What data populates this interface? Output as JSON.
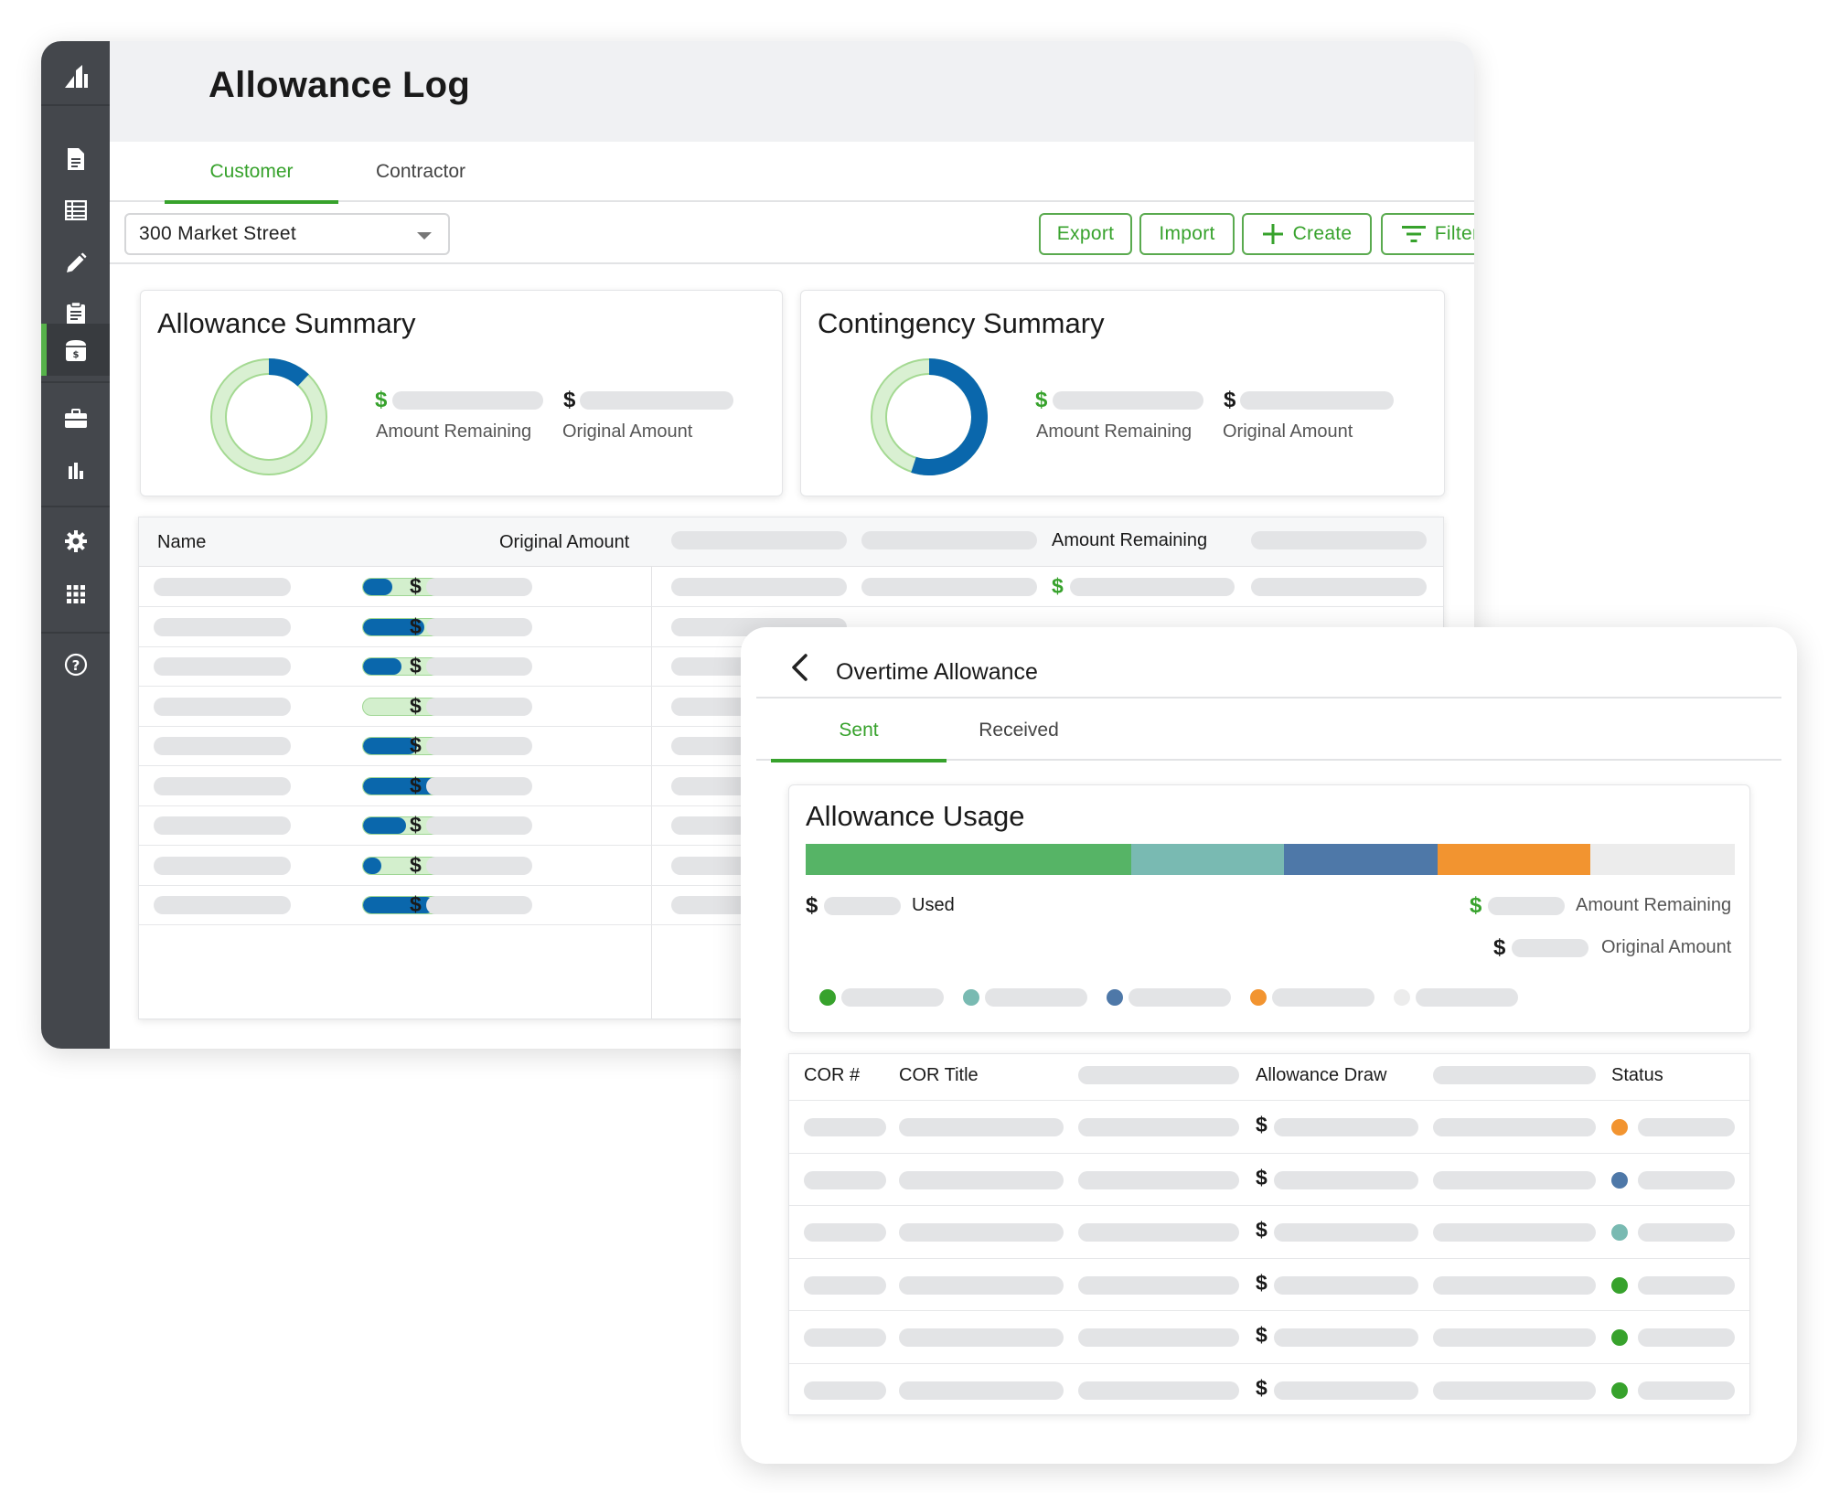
{
  "app": {
    "page_title": "Allowance Log"
  },
  "sidebar": {
    "items": [
      "logo-icon",
      "document-icon",
      "spreadsheet-icon",
      "pencil-icon",
      "clipboard-icon",
      "allowance-icon",
      "briefcase-icon",
      "bar-chart-icon",
      "gear-icon",
      "grid-icon",
      "help-icon"
    ],
    "active_item": "allowance-icon"
  },
  "tabs": [
    {
      "label": "Customer",
      "active": true
    },
    {
      "label": "Contractor",
      "active": false
    }
  ],
  "toolbar": {
    "project_value": "300 Market Street",
    "export_label": "Export",
    "import_label": "Import",
    "create_label": "Create",
    "filter_label": "Filter"
  },
  "allowance_summary": {
    "title": "Allowance Summary",
    "dollar": "$",
    "remaining_label": "Amount Remaining",
    "original_label": "Original Amount",
    "used_fraction": 0.12
  },
  "contingency_summary": {
    "title": "Contingency Summary",
    "dollar": "$",
    "remaining_label": "Amount Remaining",
    "original_label": "Original Amount",
    "used_fraction": 0.55
  },
  "allowance_table": {
    "headers": {
      "name": "Name",
      "original_amount": "Original Amount",
      "amount_remaining": "Amount Remaining"
    },
    "dollar": "$",
    "row_progress": [
      0.33,
      0.68,
      0.43,
      0.0,
      0.6,
      0.87,
      0.48,
      0.2,
      0.8
    ],
    "row_overflow": [
      0,
      0,
      0,
      0,
      0,
      0.17,
      0,
      0,
      0
    ]
  },
  "panel": {
    "title": "Overtime Allowance",
    "tabs": [
      {
        "label": "Sent",
        "active": true
      },
      {
        "label": "Received",
        "active": false
      }
    ],
    "usage": {
      "title": "Allowance Usage",
      "dollar": "$",
      "used_label": "Used",
      "remaining_label": "Amount Remaining",
      "original_label": "Original Amount",
      "segments": [
        {
          "fraction": 0.35,
          "color": "#56b466"
        },
        {
          "fraction": 0.165,
          "color": "#79bab2"
        },
        {
          "fraction": 0.165,
          "color": "#4e78a8"
        },
        {
          "fraction": 0.165,
          "color": "#f29430"
        }
      ],
      "legend_colors": [
        "#37a22c",
        "#79bab2",
        "#4e78a8",
        "#f29430",
        "#ececec"
      ]
    },
    "cor_table": {
      "headers": {
        "cor_num": "COR #",
        "cor_title": "COR Title",
        "allowance_draw": "Allowance Draw",
        "status": "Status"
      },
      "dollar": "$",
      "status_colors": [
        "#f29430",
        "#4e78a8",
        "#79bab2",
        "#37a22c",
        "#37a22c",
        "#37a22c"
      ]
    }
  },
  "colors": {
    "accent_green": "#37a22c",
    "progress_blue": "#0a67ac",
    "sidebar_bg": "#44474c"
  }
}
